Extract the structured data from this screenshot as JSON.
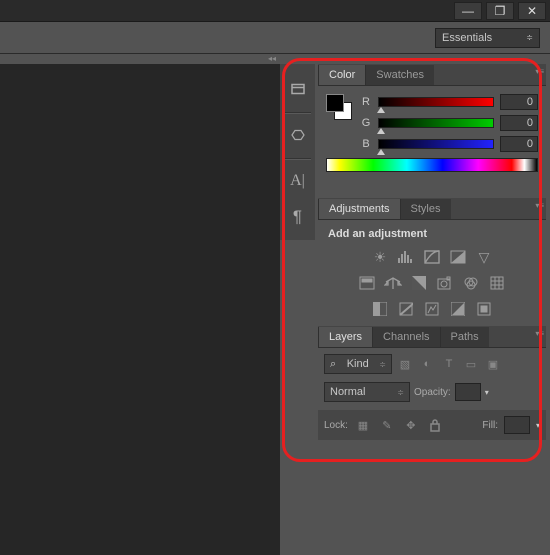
{
  "window": {
    "workspace": "Essentials"
  },
  "color": {
    "tabs": [
      "Color",
      "Swatches"
    ],
    "channels": [
      {
        "label": "R",
        "value": "0"
      },
      {
        "label": "G",
        "value": "0"
      },
      {
        "label": "B",
        "value": "0"
      }
    ]
  },
  "adjustments": {
    "tabs": [
      "Adjustments",
      "Styles"
    ],
    "title": "Add an adjustment"
  },
  "layers": {
    "tabs": [
      "Layers",
      "Channels",
      "Paths"
    ],
    "kind": "Kind",
    "blend": "Normal",
    "opacity_label": "Opacity:",
    "lock_label": "Lock:",
    "fill_label": "Fill:",
    "search_icon": "⌕"
  }
}
